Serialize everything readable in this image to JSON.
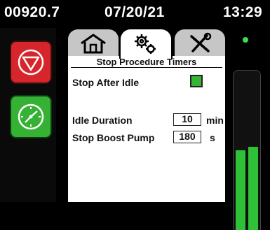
{
  "status_bar": {
    "hours": "00920.7",
    "date": "07/20/21",
    "time": "13:29"
  },
  "left_panel": {
    "stop_button_icon": "stop-triangle-icon",
    "start_button_icon": "engine-start-icon",
    "stop_color": "#d7262b",
    "start_color": "#35b233"
  },
  "tabs": [
    {
      "icon": "home-icon",
      "active": false
    },
    {
      "icon": "gears-icon",
      "active": true
    },
    {
      "icon": "tools-icon",
      "active": false
    }
  ],
  "panel": {
    "title": "Stop Procedure Timers",
    "stop_after_idle": {
      "label": "Stop After Idle",
      "checked": true
    },
    "idle_duration": {
      "label": "Idle Duration",
      "value": "10",
      "unit": "min"
    },
    "stop_boost_pump": {
      "label": "Stop Boost Pump",
      "value": "180",
      "unit": "s"
    }
  },
  "gauges": {
    "indicator_color": "#38e04a",
    "bar_color": "#2ec037",
    "levels": [
      0.5,
      0.52
    ]
  }
}
